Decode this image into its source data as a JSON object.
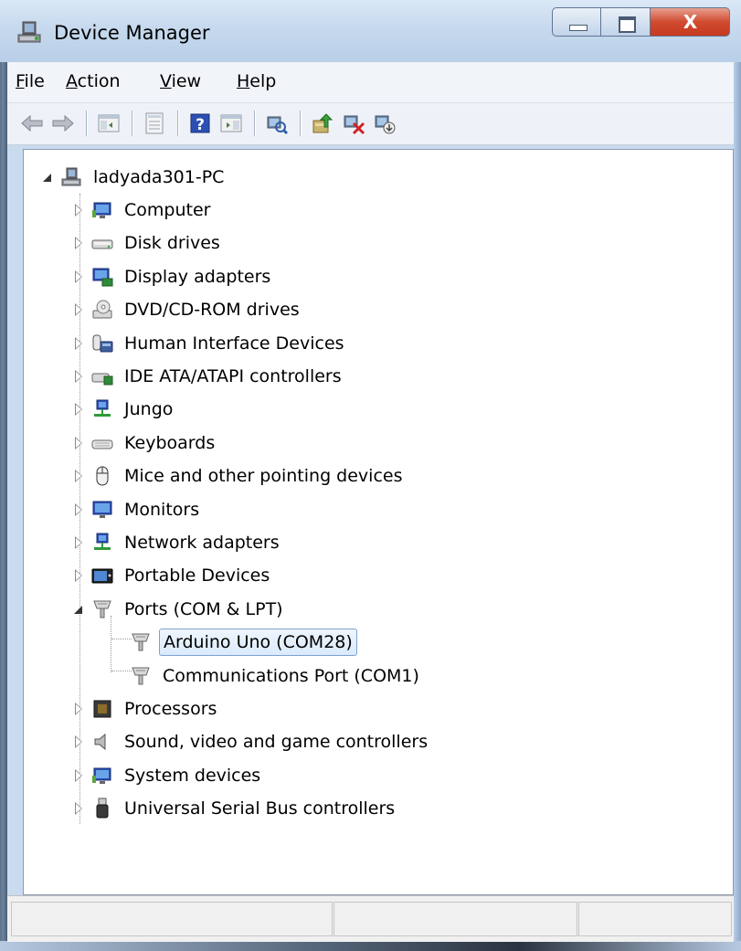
{
  "window": {
    "title": "Device Manager",
    "controls": {
      "minimize": "minimize",
      "maximize": "maximize",
      "close": "X"
    }
  },
  "menu": [
    {
      "label": "File",
      "accel": "F",
      "rest": "ile"
    },
    {
      "label": "Action",
      "accel": "A",
      "rest": "ction"
    },
    {
      "label": "View",
      "accel": "V",
      "rest": "iew"
    },
    {
      "label": "Help",
      "accel": "H",
      "rest": "elp"
    }
  ],
  "toolbar": {
    "buttons": [
      "back-arrow-icon",
      "forward-arrow-icon",
      "show-hide-console-tree-icon",
      "properties-icon",
      "help-icon",
      "show-action-pane-icon",
      "scan-hardware-icon",
      "update-driver-icon",
      "uninstall-icon",
      "disable-device-icon"
    ]
  },
  "tree": {
    "root": "ladyada301-PC",
    "categories": [
      {
        "label": "Computer",
        "icon": "computer-icon"
      },
      {
        "label": "Disk drives",
        "icon": "disk-drive-icon"
      },
      {
        "label": "Display adapters",
        "icon": "display-adapter-icon"
      },
      {
        "label": "DVD/CD-ROM drives",
        "icon": "dvd-drive-icon"
      },
      {
        "label": "Human Interface Devices",
        "icon": "hid-icon"
      },
      {
        "label": "IDE ATA/ATAPI controllers",
        "icon": "ide-controller-icon"
      },
      {
        "label": "Jungo",
        "icon": "network-icon"
      },
      {
        "label": "Keyboards",
        "icon": "keyboard-icon"
      },
      {
        "label": "Mice and other pointing devices",
        "icon": "mouse-icon"
      },
      {
        "label": "Monitors",
        "icon": "monitor-icon"
      },
      {
        "label": "Network adapters",
        "icon": "network-adapter-icon"
      },
      {
        "label": "Portable Devices",
        "icon": "portable-device-icon"
      },
      {
        "label": "Ports (COM & LPT)",
        "icon": "port-icon",
        "expanded": true
      },
      {
        "label": "Processors",
        "icon": "processor-icon"
      },
      {
        "label": "Sound, video and game controllers",
        "icon": "speaker-icon"
      },
      {
        "label": "System devices",
        "icon": "system-device-icon"
      },
      {
        "label": "Universal Serial Bus controllers",
        "icon": "usb-icon"
      }
    ],
    "ports_children": [
      {
        "label": "Arduino Uno (COM28)",
        "selected": true
      },
      {
        "label": "Communications Port (COM1)",
        "selected": false
      }
    ]
  },
  "status": {
    "pane1": "",
    "pane2": "",
    "pane3": ""
  },
  "colors": {
    "selection_border": "#7da2ce",
    "selection_fill": "#dbeafc",
    "title_bar": "#c6d9ee",
    "close_button": "#c63a1e"
  }
}
